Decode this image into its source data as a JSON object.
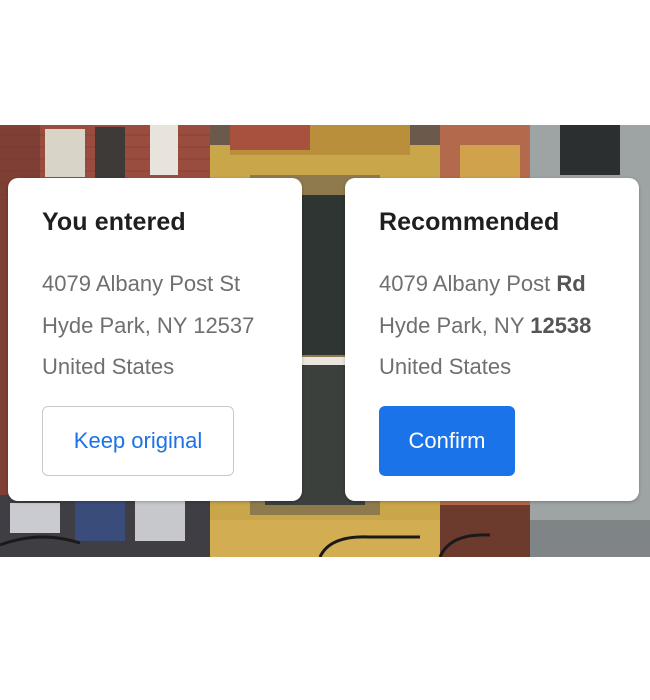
{
  "left_card": {
    "title": "You entered",
    "line1": "4079 Albany Post St",
    "line2": "Hyde Park, NY 12537",
    "line3": "United States",
    "button_label": "Keep original"
  },
  "right_card": {
    "title": "Recommended",
    "line1_prefix": "4079 Albany Post ",
    "line1_changed": "Rd",
    "line2_prefix": "Hyde Park, NY ",
    "line2_changed": "12538",
    "line3": "United States",
    "button_label": "Confirm"
  },
  "colors": {
    "accent": "#1a73e8",
    "title_text": "#1f1f1f",
    "address_text": "#6f6f6f"
  }
}
